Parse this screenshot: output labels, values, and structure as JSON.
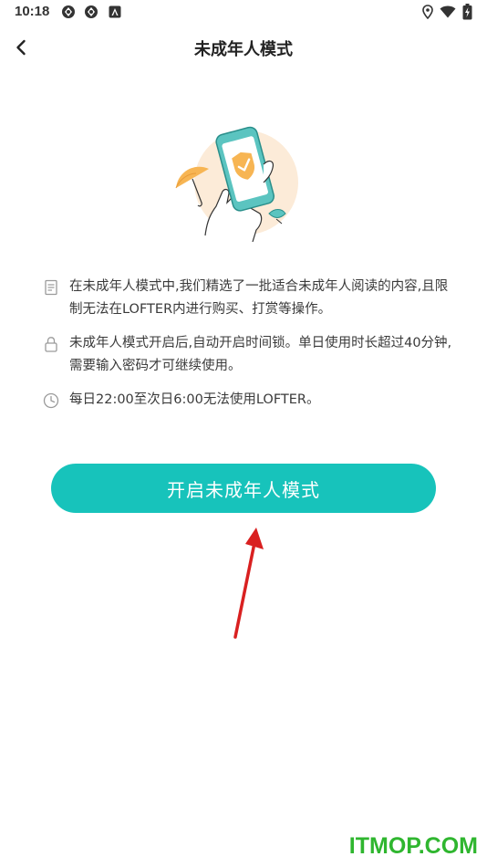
{
  "status_bar": {
    "time": "10:18"
  },
  "header": {
    "title": "未成年人模式"
  },
  "info_items": [
    {
      "icon": "document-icon",
      "text": "在未成年人模式中,我们精选了一批适合未成年人阅读的内容,且限制无法在LOFTER内进行购买、打赏等操作。"
    },
    {
      "icon": "lock-icon",
      "text": "未成年人模式开启后,自动开启时间锁。单日使用时长超过40分钟,需要输入密码才可继续使用。"
    },
    {
      "icon": "clock-icon",
      "text": "每日22:00至次日6:00无法使用LOFTER。"
    }
  ],
  "enable_button": {
    "label": "开启未成年人模式"
  },
  "watermark": {
    "text": "ITMOP.COM"
  },
  "colors": {
    "accent": "#17c3bb",
    "annotation_arrow": "#d92020",
    "watermark": "#2fb62f"
  }
}
